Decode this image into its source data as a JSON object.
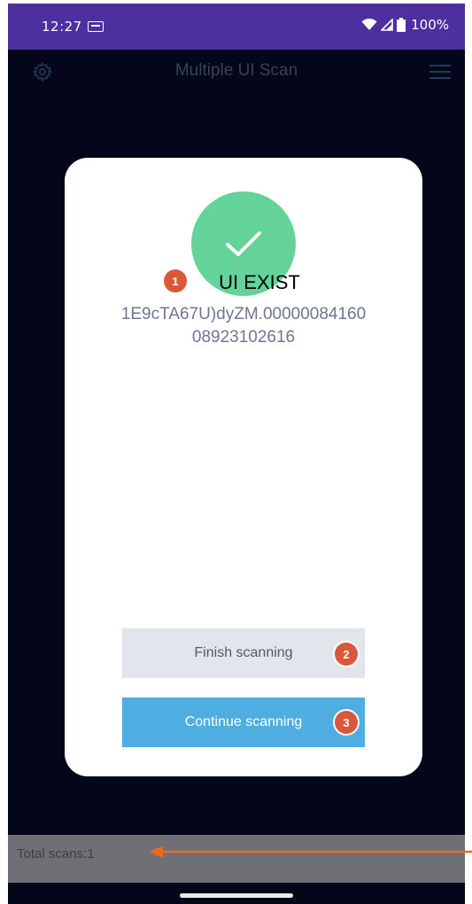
{
  "status_bar": {
    "time": "12:27",
    "battery": "100%"
  },
  "app_bar": {
    "title": "Multiple UI Scan",
    "settings_icon": "gear-icon",
    "menu_icon": "hamburger-menu-icon"
  },
  "dialog": {
    "status_icon": "checkmark-icon",
    "title": "UI EXIST",
    "code_line1": "1E9cTA67U)dyZM.00000084160",
    "code_line2": "08923102616",
    "finish_label": "Finish scanning",
    "continue_label": "Continue scanning"
  },
  "annotations": {
    "badge_1": "1",
    "badge_2": "2",
    "badge_3": "3"
  },
  "footer": {
    "total_scans": "Total scans:1"
  },
  "colors": {
    "status_bar": "#4d2f9e",
    "background": "#04061a",
    "success": "#63d39a",
    "primary_button": "#4eaee2",
    "secondary_button": "#e3e5ec",
    "badge": "#d9583a",
    "arrow": "#e86a1e"
  }
}
